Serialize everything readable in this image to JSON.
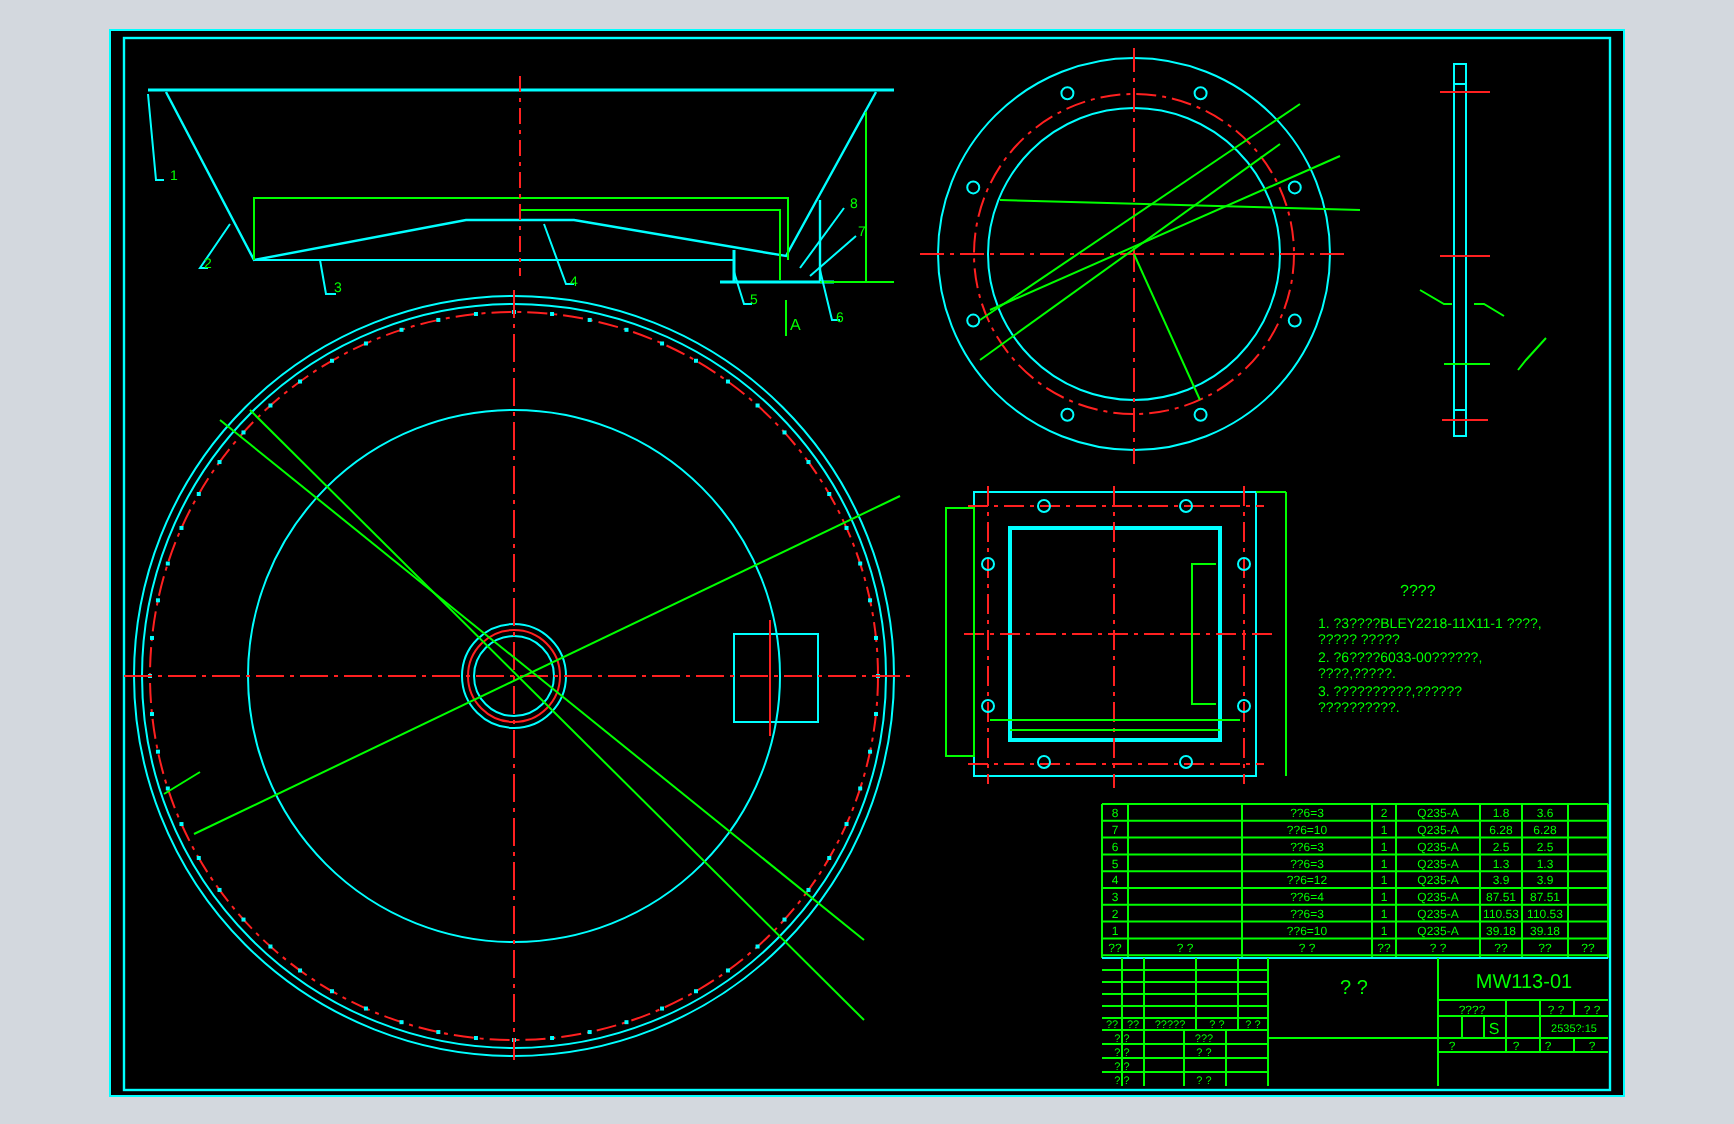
{
  "section_view": {
    "callouts": [
      {
        "label": "1"
      },
      {
        "label": "2"
      },
      {
        "label": "3"
      },
      {
        "label": "4"
      },
      {
        "label": "5"
      },
      {
        "label": "6"
      },
      {
        "label": "7"
      },
      {
        "label": "8"
      }
    ],
    "section_mark": "A"
  },
  "notes": {
    "title": "????",
    "items": [
      {
        "lines": [
          "1. ?3????BLEY2218-11X11-1 ????,",
          "????? ?????"
        ]
      },
      {
        "lines": [
          "2. ?6????6033-00??????,",
          "????,?????."
        ]
      },
      {
        "lines": [
          "3. ??????????,??????",
          "??????????."
        ]
      }
    ]
  },
  "parts_table": {
    "columns": [
      "??",
      "? ?",
      "? ?",
      "??",
      "? ?",
      "??",
      "??",
      "??"
    ],
    "rows": [
      {
        "no": "8",
        "spec": "??6=3",
        "qty": "2",
        "material": "Q235-A",
        "unit_weight": "1.8",
        "total_weight": "3.6"
      },
      {
        "no": "7",
        "spec": "??6=10",
        "qty": "1",
        "material": "Q235-A",
        "unit_weight": "6.28",
        "total_weight": "6.28"
      },
      {
        "no": "6",
        "spec": "??6=3",
        "qty": "1",
        "material": "Q235-A",
        "unit_weight": "2.5",
        "total_weight": "2.5"
      },
      {
        "no": "5",
        "spec": "??6=3",
        "qty": "1",
        "material": "Q235-A",
        "unit_weight": "1.3",
        "total_weight": "1.3"
      },
      {
        "no": "4",
        "spec": "??6=12",
        "qty": "1",
        "material": "Q235-A",
        "unit_weight": "3.9",
        "total_weight": "3.9"
      },
      {
        "no": "3",
        "spec": "??6=4",
        "qty": "1",
        "material": "Q235-A",
        "unit_weight": "87.51",
        "total_weight": "87.51"
      },
      {
        "no": "2",
        "spec": "??6=3",
        "qty": "1",
        "material": "Q235-A",
        "unit_weight": "110.53",
        "total_weight": "110.53"
      },
      {
        "no": "1",
        "spec": "??6=10",
        "qty": "1",
        "material": "Q235-A",
        "unit_weight": "39.18",
        "total_weight": "39.18"
      }
    ]
  },
  "title_block": {
    "title": "? ?",
    "drawing_no": "MW113-01",
    "sign_labels": [
      "??",
      "??",
      "?????",
      "? ?",
      "? ?"
    ],
    "left_rows": [
      {
        "role": "? ?",
        "name": "???"
      },
      {
        "role": "? ?",
        "name": "? ?"
      },
      {
        "role": "? ?",
        "name": ""
      },
      {
        "role": "? ?",
        "name": "? ?"
      }
    ],
    "stage_label": "????",
    "weight_label": "? ?",
    "scale_label": "? ?",
    "stage_mark": "S",
    "scale": "2535?:15",
    "bottom_labels": [
      "?",
      "?",
      "?",
      "?"
    ]
  }
}
